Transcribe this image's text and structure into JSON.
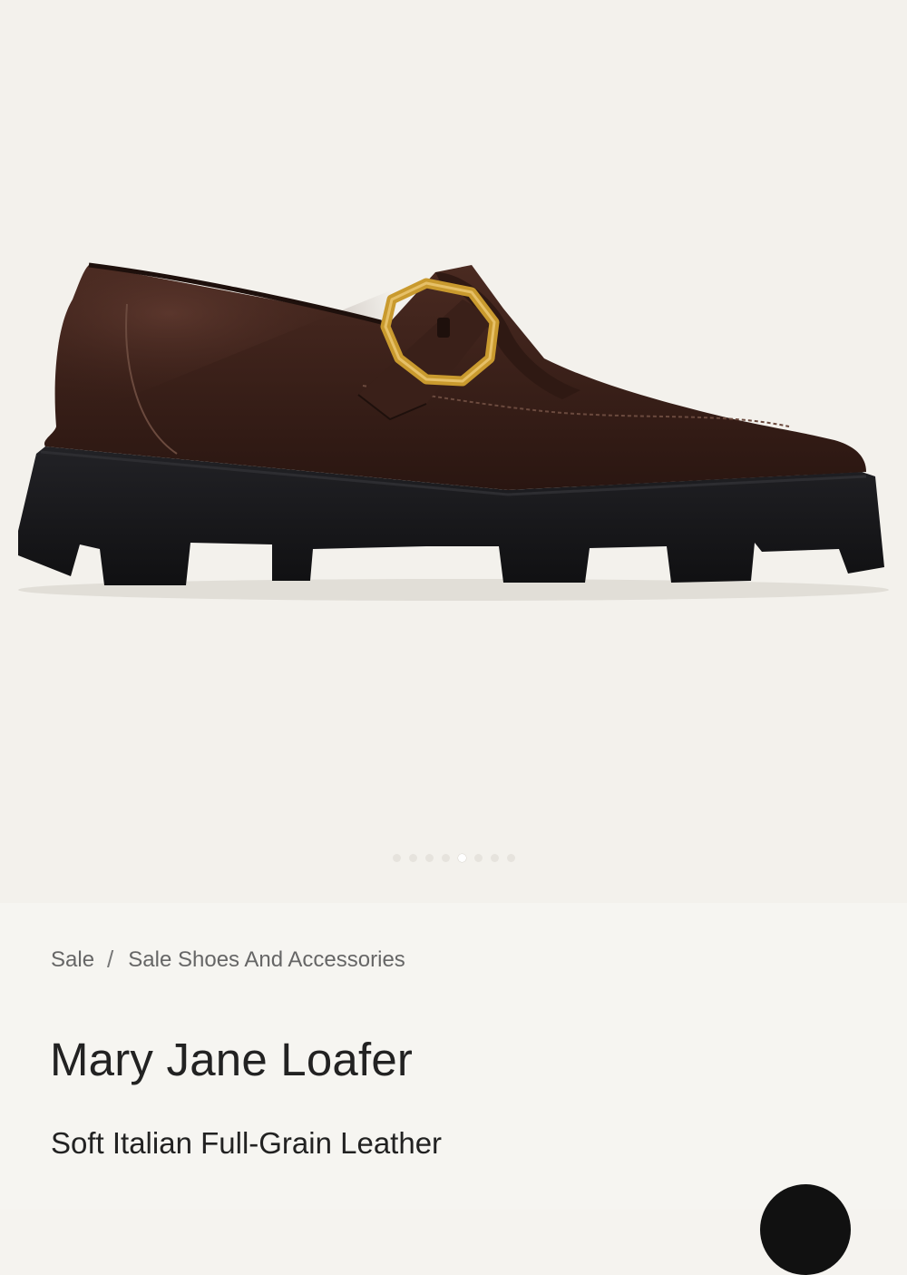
{
  "gallery": {
    "image_alt": "Mary Jane Loafer in dark brown leather with gold buckle on lug sole",
    "dot_count": 8,
    "active_index": 4
  },
  "breadcrumb": {
    "items": [
      "Sale",
      "Sale Shoes And Accessories"
    ],
    "separator": "/"
  },
  "product": {
    "title": "Mary Jane Loafer",
    "subtitle": "Soft Italian Full-Grain Leather"
  },
  "colors": {
    "background": "#f3f1ec",
    "leather": "#3b2119",
    "sole": "#18181b",
    "buckle": "#c99a2e"
  }
}
